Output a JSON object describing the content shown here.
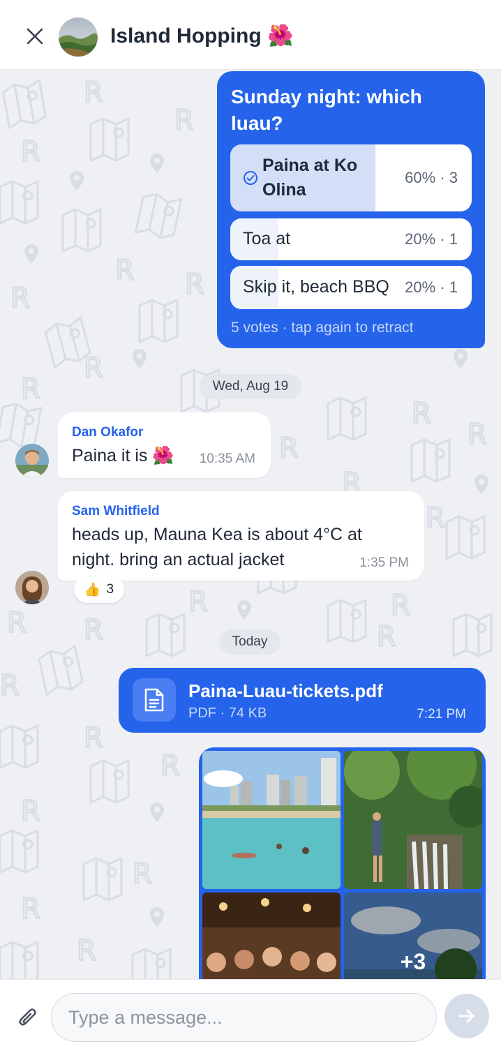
{
  "header": {
    "title": "Island Hopping 🌺",
    "close_icon": "close-icon",
    "avatar_icon": "group-avatar"
  },
  "poll": {
    "question": "Sunday night: which luau?",
    "options": [
      {
        "label": "Paina at Ko Olina",
        "stat": "60% · 3",
        "percent": 60,
        "selected": true
      },
      {
        "label": "Toa at",
        "stat": "20% · 1",
        "percent": 20,
        "selected": false
      },
      {
        "label": "Skip it, beach BBQ",
        "stat": "20% · 1",
        "percent": 20,
        "selected": false
      }
    ],
    "footer": "5 votes · tap again to retract"
  },
  "dates": {
    "first": "Wed, Aug 19",
    "second": "Today"
  },
  "messages": [
    {
      "sender": "Dan Okafor",
      "text": "Paina it is 🌺",
      "time": "10:35 AM"
    },
    {
      "sender": "Sam Whitfield",
      "text": "heads up, Mauna Kea is about 4°C at night. bring an actual jacket",
      "time": "1:35 PM",
      "reaction": {
        "emoji": "👍",
        "count": "3"
      }
    }
  ],
  "file": {
    "name": "Paina-Luau-tickets.pdf",
    "meta": "PDF · 74 KB",
    "time": "7:21 PM",
    "icon": "document-icon"
  },
  "gallery": {
    "more_label": "+3"
  },
  "composer": {
    "placeholder": "Type a message...",
    "attach_icon": "paperclip-icon",
    "send_icon": "send-arrow-icon"
  },
  "colors": {
    "accent": "#2563eb",
    "background": "#eef0f4",
    "poll_fill": "#d3def7"
  }
}
